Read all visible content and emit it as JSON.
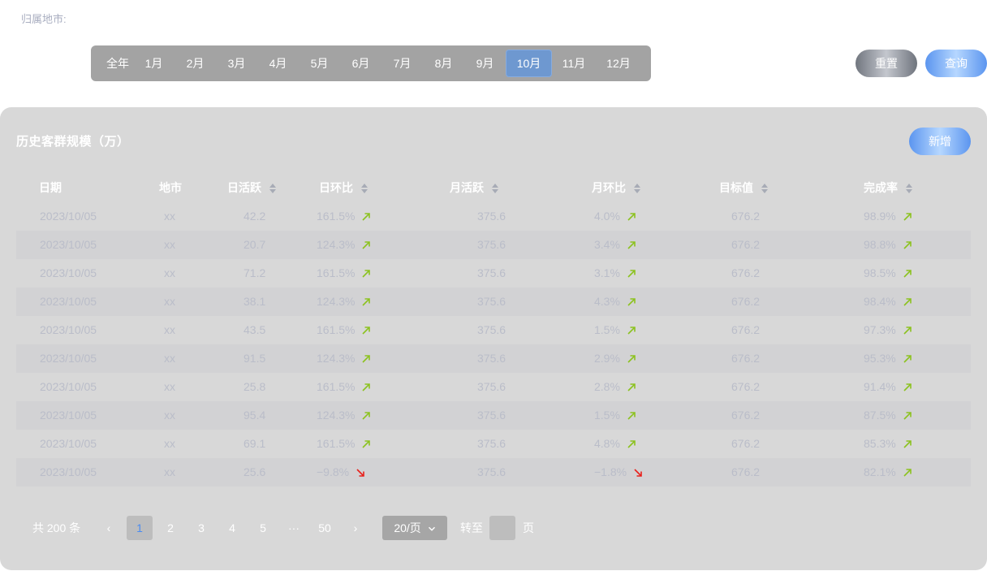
{
  "filter": {
    "label": "归属地市:"
  },
  "months": [
    "全年",
    "1月",
    "2月",
    "3月",
    "4月",
    "5月",
    "6月",
    "7月",
    "8月",
    "9月",
    "10月",
    "11月",
    "12月"
  ],
  "active_month": "10月",
  "actions": {
    "reset_label": "重置",
    "query_label": "查询"
  },
  "panel": {
    "title": "历史客群规模（万）",
    "add_label": "新增"
  },
  "table": {
    "headers": [
      "日期",
      "地市",
      "日活跃",
      "日环比",
      "月活跃",
      "月环比",
      "目标值",
      "完成率"
    ],
    "rows": [
      {
        "date": "2023/10/05",
        "city": "xx",
        "dau": "42.2",
        "dau_change": "161.5%",
        "dau_trend": "up",
        "mau": "375.6",
        "mau_change": "4.0%",
        "mau_trend": "up",
        "target": "676.2",
        "rate": "98.9%",
        "rate_trend": "up"
      },
      {
        "date": "2023/10/05",
        "city": "xx",
        "dau": "20.7",
        "dau_change": "124.3%",
        "dau_trend": "up",
        "mau": "375.6",
        "mau_change": "3.4%",
        "mau_trend": "up",
        "target": "676.2",
        "rate": "98.8%",
        "rate_trend": "up"
      },
      {
        "date": "2023/10/05",
        "city": "xx",
        "dau": "71.2",
        "dau_change": "161.5%",
        "dau_trend": "up",
        "mau": "375.6",
        "mau_change": "3.1%",
        "mau_trend": "up",
        "target": "676.2",
        "rate": "98.5%",
        "rate_trend": "up"
      },
      {
        "date": "2023/10/05",
        "city": "xx",
        "dau": "38.1",
        "dau_change": "124.3%",
        "dau_trend": "up",
        "mau": "375.6",
        "mau_change": "4.3%",
        "mau_trend": "up",
        "target": "676.2",
        "rate": "98.4%",
        "rate_trend": "up"
      },
      {
        "date": "2023/10/05",
        "city": "xx",
        "dau": "43.5",
        "dau_change": "161.5%",
        "dau_trend": "up",
        "mau": "375.6",
        "mau_change": "1.5%",
        "mau_trend": "up",
        "target": "676.2",
        "rate": "97.3%",
        "rate_trend": "up"
      },
      {
        "date": "2023/10/05",
        "city": "xx",
        "dau": "91.5",
        "dau_change": "124.3%",
        "dau_trend": "up",
        "mau": "375.6",
        "mau_change": "2.9%",
        "mau_trend": "up",
        "target": "676.2",
        "rate": "95.3%",
        "rate_trend": "up"
      },
      {
        "date": "2023/10/05",
        "city": "xx",
        "dau": "25.8",
        "dau_change": "161.5%",
        "dau_trend": "up",
        "mau": "375.6",
        "mau_change": "2.8%",
        "mau_trend": "up",
        "target": "676.2",
        "rate": "91.4%",
        "rate_trend": "up"
      },
      {
        "date": "2023/10/05",
        "city": "xx",
        "dau": "95.4",
        "dau_change": "124.3%",
        "dau_trend": "up",
        "mau": "375.6",
        "mau_change": "1.5%",
        "mau_trend": "up",
        "target": "676.2",
        "rate": "87.5%",
        "rate_trend": "up"
      },
      {
        "date": "2023/10/05",
        "city": "xx",
        "dau": "69.1",
        "dau_change": "161.5%",
        "dau_trend": "up",
        "mau": "375.6",
        "mau_change": "4.8%",
        "mau_trend": "up",
        "target": "676.2",
        "rate": "85.3%",
        "rate_trend": "up"
      },
      {
        "date": "2023/10/05",
        "city": "xx",
        "dau": "25.6",
        "dau_change": "−9.8%",
        "dau_trend": "down",
        "mau": "375.6",
        "mau_change": "−1.8%",
        "mau_trend": "down",
        "target": "676.2",
        "rate": "82.1%",
        "rate_trend": "up"
      }
    ]
  },
  "trend_colors": {
    "up": "#8cc21f",
    "down": "#e8201b"
  },
  "pagination": {
    "total_prefix": "共",
    "total": "200",
    "total_suffix": "条",
    "prev_icon": "‹",
    "pages": [
      "1",
      "2",
      "3",
      "4",
      "5"
    ],
    "ellipsis": "···",
    "last_page": "50",
    "next_icon": "›",
    "active_page": "1",
    "page_size": "20/页",
    "jump_label": "转至",
    "jump_value": "",
    "page_suffix": "页"
  }
}
